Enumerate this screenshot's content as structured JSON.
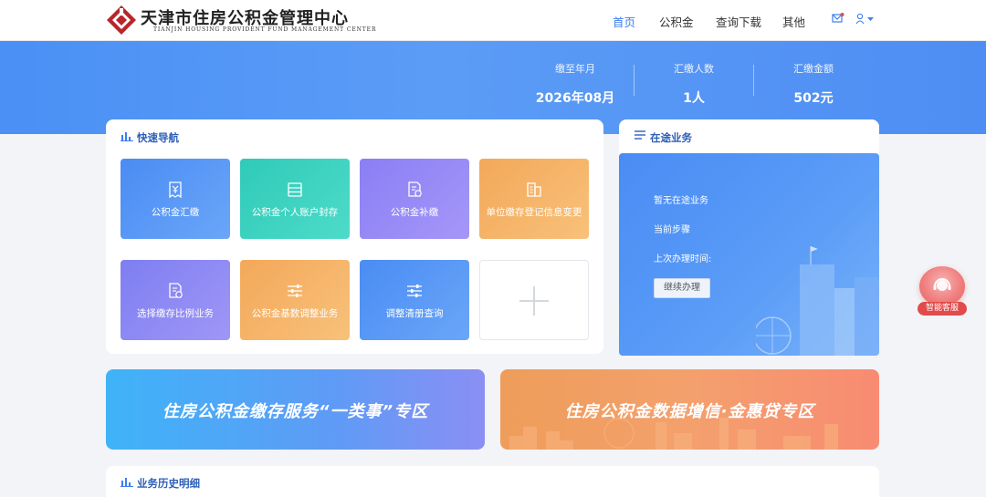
{
  "header": {
    "logo_cn": "天津市住房公积金管理中心",
    "logo_en": "TIANJIN HOUSING PROVIDENT FUND MANAGEMENT CENTER",
    "nav": [
      "首页",
      "公积金",
      "查询下载",
      "其他"
    ],
    "accent_color": "#3a7ef0"
  },
  "stats": [
    {
      "label": "缴至年月",
      "value": "2026年08月"
    },
    {
      "label": "汇缴人数",
      "value": "1人"
    },
    {
      "label": "汇缴金额",
      "value": "502元"
    }
  ],
  "quick_nav": {
    "title": "快速导航",
    "tiles": [
      {
        "label": "公积金汇缴",
        "icon": "receipt-yen-icon"
      },
      {
        "label": "公积金个人账户封存",
        "icon": "archive-box-icon"
      },
      {
        "label": "公积金补缴",
        "icon": "document-settings-icon"
      },
      {
        "label": "单位缴存登记信息变更",
        "icon": "building-icon"
      },
      {
        "label": "选择缴存比例业务",
        "icon": "document-refresh-icon"
      },
      {
        "label": "公积金基数调整业务",
        "icon": "sliders-icon"
      },
      {
        "label": "调整清册查询",
        "icon": "sliders-icon"
      },
      {
        "label": "",
        "icon": "plus-icon"
      }
    ]
  },
  "ongoing": {
    "title": "在途业务",
    "status": "暂无在途业务",
    "step": "当前步骤",
    "last_time": "上次办理时间:",
    "continue_button": "继续办理"
  },
  "promos": [
    {
      "label": "住房公积金缴存服务“一类事”专区"
    },
    {
      "label": "住房公积金数据增信·金惠贷专区"
    }
  ],
  "history": {
    "title": "业务历史明细"
  },
  "service": {
    "label": "智能客服"
  }
}
